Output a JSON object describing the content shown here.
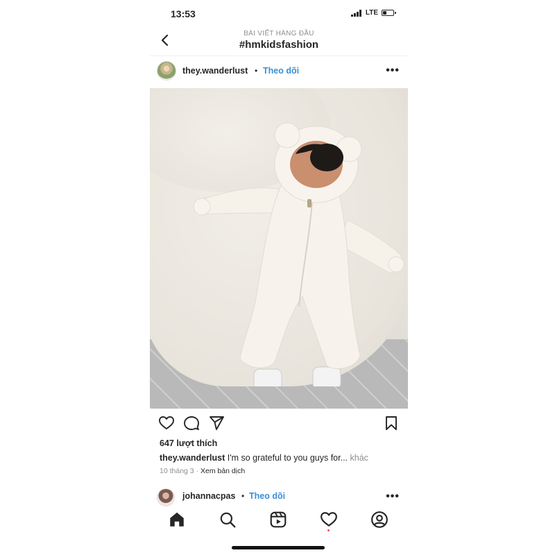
{
  "status_bar": {
    "time": "13:53",
    "network": "LTE",
    "battery_level": 0.3
  },
  "nav": {
    "subtitle": "BÀI VIẾT HÀNG ĐẦU",
    "title": "#hmkidsfashion",
    "back_icon": "chevron-left-icon"
  },
  "post": {
    "username": "they.wanderlust",
    "separator": "•",
    "follow_label": "Theo dõi",
    "more_icon": "more-horizontal-icon",
    "image_subject": "baby-in-white-bear-onesie",
    "likes": "647 lượt thích",
    "caption_user": "they.wanderlust",
    "caption_text": "I'm so grateful to you guys for...",
    "caption_more": "khác",
    "date": "10 tháng 3",
    "meta_separator": "·",
    "translate_label": "Xem bản dịch"
  },
  "comment": {
    "username": "johannacpas",
    "separator": "•",
    "follow_label": "Theo dõi"
  },
  "colors": {
    "accent": "#3a8fd6",
    "text": "#262626",
    "muted": "#8e8e8e",
    "notification": "#ed4956"
  },
  "tabs": [
    "home-icon",
    "search-icon",
    "reels-icon",
    "heart-icon",
    "profile-icon"
  ]
}
